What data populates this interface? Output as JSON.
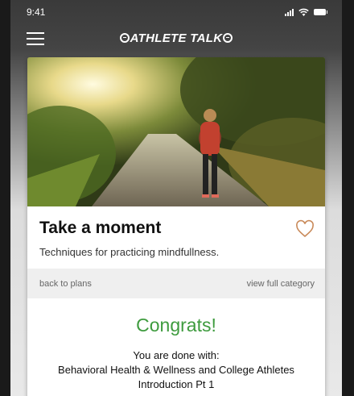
{
  "status": {
    "time": "9:41"
  },
  "nav": {
    "logo_text": "ATHLETE TALK",
    "menu_icon": "hamburger-menu-icon"
  },
  "card": {
    "title": "Take a moment",
    "subtitle": "Techniques for practicing mindfullness.",
    "heart_color": "#c98a5a",
    "back_label": "back to plans",
    "category_label": "view full category"
  },
  "completion": {
    "congrats": "Congrats!",
    "done_label": "You are done with:",
    "course_line1": "Behavioral Health & Wellness and College Athletes",
    "course_line2": "Introduction Pt 1",
    "accent_color": "#3e9b3e"
  }
}
